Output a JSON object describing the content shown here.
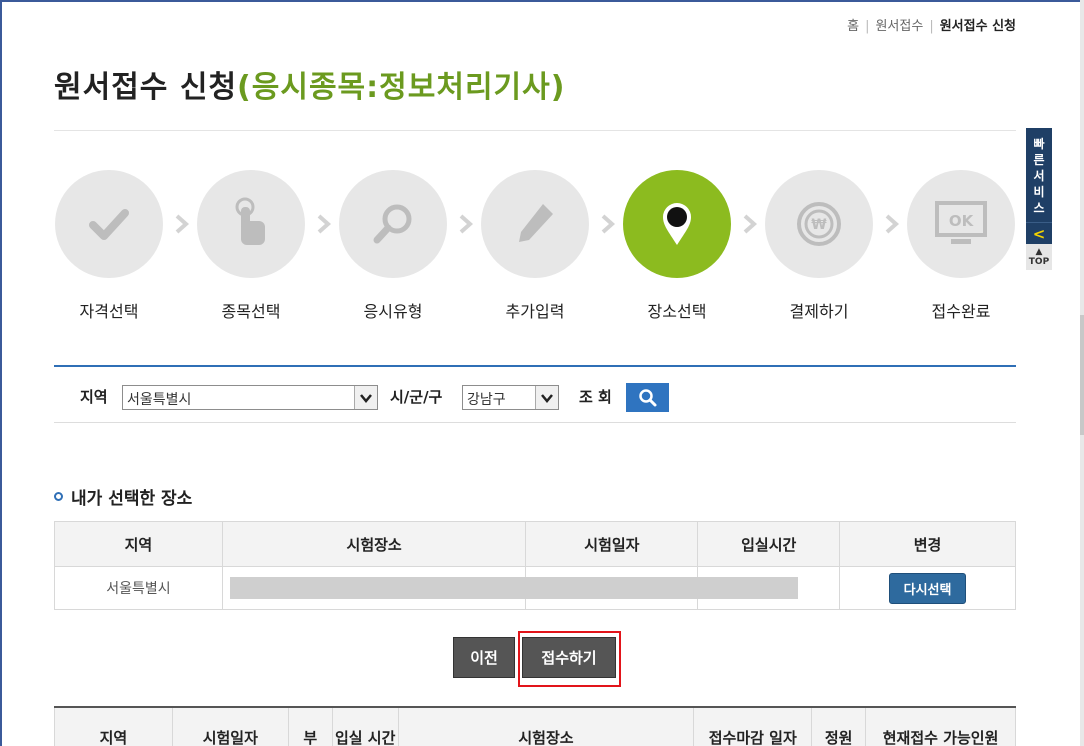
{
  "breadcrumb": {
    "home": "홈",
    "mid": "원서접수",
    "current": "원서접수 신청"
  },
  "title": {
    "main": "원서접수 신청",
    "sub": "(응시종목:정보처리기사)"
  },
  "steps": [
    {
      "label": "자격선택",
      "icon": "check-icon"
    },
    {
      "label": "종목선택",
      "icon": "hand-pointer-icon"
    },
    {
      "label": "응시유형",
      "icon": "magnifier-icon"
    },
    {
      "label": "추가입력",
      "icon": "pencil-icon"
    },
    {
      "label": "장소선택",
      "icon": "map-pin-icon",
      "active": true
    },
    {
      "label": "결제하기",
      "icon": "won-coin-icon"
    },
    {
      "label": "접수완료",
      "icon": "ok-monitor-icon"
    }
  ],
  "quick": {
    "label": "빠른서비스",
    "top": "TOP"
  },
  "search": {
    "region_label": "지역",
    "region_value": "서울특별시",
    "district_label": "시/군/구",
    "district_value": "강남구",
    "query_label": "조 회"
  },
  "my_place": {
    "title": "내가 선택한 장소",
    "headers": [
      "지역",
      "시험장소",
      "시험일자",
      "입실시간",
      "변경"
    ],
    "row": {
      "region": "서울특별시",
      "reselect": "다시선택"
    }
  },
  "buttons": {
    "prev": "이전",
    "submit": "접수하기"
  },
  "list": {
    "headers": [
      "지역",
      "시험일자",
      "부",
      "입실 시간",
      "시험장소",
      "접수마감 일자",
      "정원",
      "현재접수 가능인원"
    ]
  },
  "colors": {
    "accent": "#8cbb1f",
    "primary": "#2f74c0",
    "highlight": "#e2141a"
  }
}
